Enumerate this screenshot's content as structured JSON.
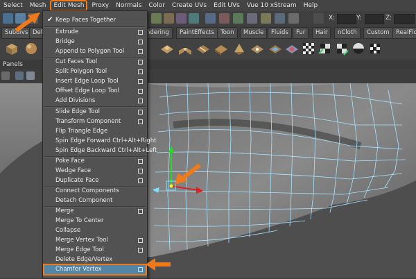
{
  "menubar": {
    "items": [
      "Select",
      "Mesh",
      "Edit Mesh",
      "Proxy",
      "Normals",
      "Color",
      "Create UVs",
      "Edit UVs",
      "Vue 10 xStream",
      "Help"
    ],
    "active_index": 2
  },
  "statusline": {
    "x_label": "X:",
    "y_label": "Y:",
    "z_label": "Z:"
  },
  "shelf": {
    "tabs": [
      "Subdivs",
      "Defo",
      "ndering",
      "PaintEffects",
      "Toon",
      "Muscle",
      "Fluids",
      "Fur",
      "Hair",
      "nCloth",
      "Custom",
      "RealFlo"
    ]
  },
  "panels": {
    "label": "Panels"
  },
  "menu": {
    "items": [
      {
        "label": "Keep Faces Together",
        "checked": true,
        "option_box": false
      },
      {
        "label": "Extrude",
        "option_box": true
      },
      {
        "label": "Bridge",
        "option_box": true
      },
      {
        "label": "Append to Polygon Tool",
        "option_box": true
      },
      {
        "label": "Cut Faces Tool",
        "option_box": true
      },
      {
        "label": "Split Polygon Tool",
        "option_box": true
      },
      {
        "label": "Insert Edge Loop Tool",
        "option_box": true
      },
      {
        "label": "Offset Edge Loop Tool",
        "option_box": true
      },
      {
        "label": "Add Divisions",
        "option_box": true
      },
      {
        "label": "Slide Edge Tool",
        "option_box": true
      },
      {
        "label": "Transform Component",
        "option_box": true
      },
      {
        "label": "Flip Triangle Edge",
        "option_box": false
      },
      {
        "label": "Spin Edge Forward  Ctrl+Alt+Right",
        "option_box": false
      },
      {
        "label": "Spin Edge Backward  Ctrl+Alt+Left",
        "option_box": false
      },
      {
        "label": "Poke Face",
        "option_box": true
      },
      {
        "label": "Wedge Face",
        "option_box": true
      },
      {
        "label": "Duplicate Face",
        "option_box": true
      },
      {
        "label": "Connect Components",
        "option_box": false
      },
      {
        "label": "Detach Component",
        "option_box": false
      },
      {
        "label": "Merge",
        "option_box": true
      },
      {
        "label": "Merge To Center",
        "option_box": false
      },
      {
        "label": "Collapse",
        "option_box": false
      },
      {
        "label": "Merge Vertex Tool",
        "option_box": true
      },
      {
        "label": "Merge Edge Tool",
        "option_box": true
      },
      {
        "label": "Delete Edge/Vertex",
        "option_box": false
      },
      {
        "label": "Chamfer Vertex",
        "option_box": true,
        "highlighted": true
      }
    ]
  },
  "colors": {
    "accent": "#f07a1a",
    "highlight": "#5285a6",
    "wire": "#9fdcff"
  }
}
